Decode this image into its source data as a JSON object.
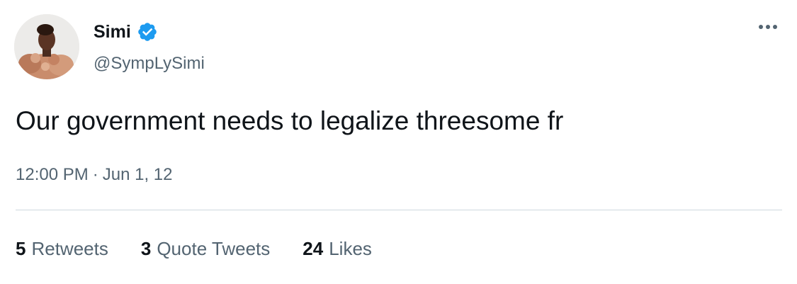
{
  "tweet": {
    "author": {
      "display_name": "Simi",
      "handle": "@SympLySimi",
      "verified": true,
      "avatar_icon": "profile-photo"
    },
    "more_icon": "more-horizontal-icon",
    "text": "Our government needs to legalize threesome fr",
    "time": "12:00 PM",
    "separator": "·",
    "date": "Jun 1, 12",
    "stats": {
      "retweets_count": "5",
      "retweets_label": "Retweets",
      "quotes_count": "3",
      "quotes_label": "Quote Tweets",
      "likes_count": "24",
      "likes_label": "Likes"
    }
  },
  "colors": {
    "text_primary": "#0f1419",
    "text_secondary": "#536471",
    "verified_blue": "#1d9bf0",
    "divider": "#cfd9de"
  }
}
